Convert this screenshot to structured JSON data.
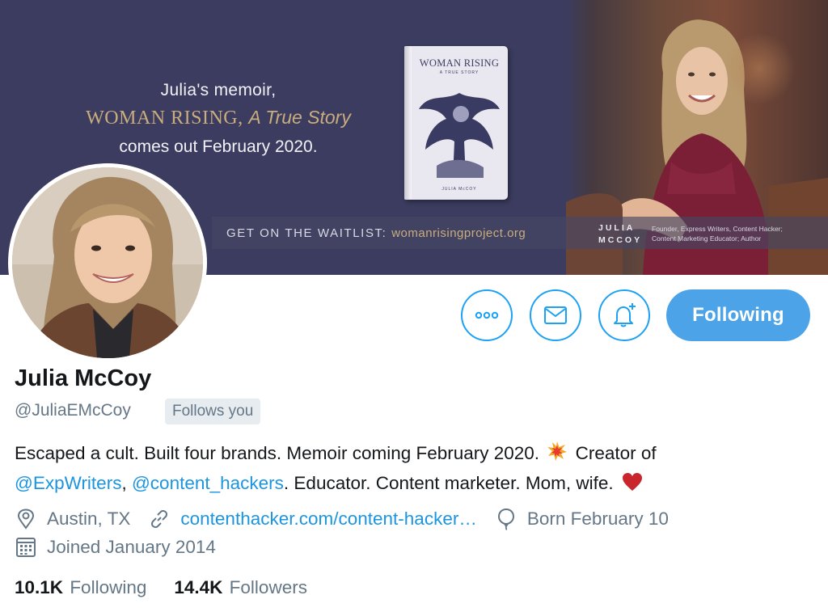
{
  "banner": {
    "line1": "Julia's memoir,",
    "title": "WOMAN RISING,",
    "subtitle": "A True Story",
    "line3": "comes out February 2020.",
    "book_title": "WOMAN RISING",
    "book_sub": "A TRUE STORY",
    "book_author": "JULIA McCOY",
    "waitlist_label": "GET ON THE WAITLIST: ",
    "waitlist_url": "womanrisingproject.org",
    "name_tag_1": "JULIA",
    "name_tag_2": "MCCOY",
    "desc_1": "Founder, Express Writers, Content Hacker;",
    "desc_2": "Content Marketing Educator; Author"
  },
  "actions": {
    "more_icon": "more-icon",
    "message_icon": "envelope-icon",
    "notify_icon": "bell-plus-icon",
    "following_label": "Following"
  },
  "profile": {
    "name": "Julia McCoy",
    "handle": "@JuliaEMcCoy",
    "follows_you": "Follows you",
    "bio": {
      "part1": "Escaped a cult. Built four brands. Memoir coming February 2020.",
      "part2": " Creator of",
      "mention1": "@ExpWriters",
      "sep": ", ",
      "mention2": "@content_hackers",
      "part3": ". Educator. Content marketer. Mom, wife."
    },
    "location": "Austin, TX",
    "website": "contenthacker.com/content-hacker…",
    "birthday": "Born February 10",
    "joined": "Joined January 2014"
  },
  "stats": {
    "following_count": "10.1K",
    "following_label": "Following",
    "followers_count": "14.4K",
    "followers_label": "Followers"
  },
  "colors": {
    "accent": "#1da1f2",
    "link": "#1b95e0",
    "following_bg": "#4ca3e8",
    "secondary_text": "#657786",
    "banner_bg": "#3b3c5f"
  }
}
